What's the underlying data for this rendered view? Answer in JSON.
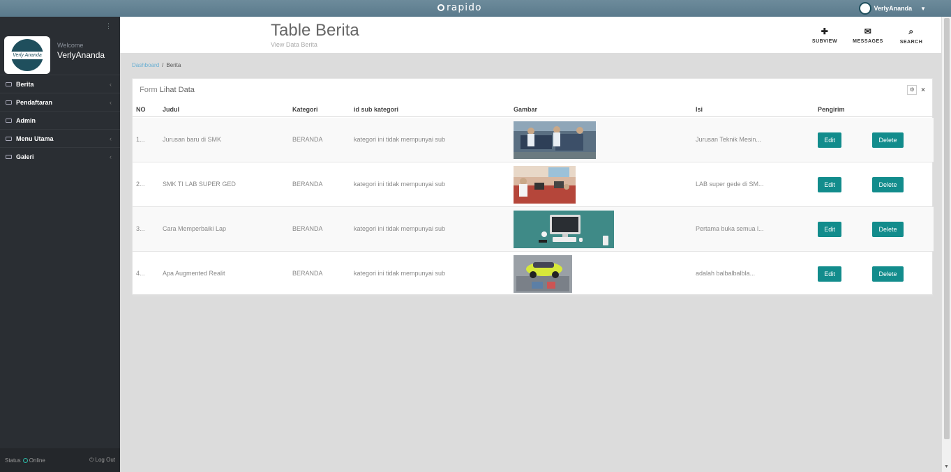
{
  "topbar": {
    "brand": "rapido",
    "user": "VerlyAnanda"
  },
  "sidebar": {
    "welcome": "Welcome",
    "username": "VerlyAnanda",
    "avatar_text": "Verly Ananda",
    "items": [
      {
        "label": "Berita"
      },
      {
        "label": "Pendaftaran"
      },
      {
        "label": "Admin"
      },
      {
        "label": "Menu Utama"
      },
      {
        "label": "Galeri"
      }
    ],
    "footer": {
      "status_label": "Status",
      "status_value": "Online",
      "logout": "Log Out"
    }
  },
  "header": {
    "title": "Table Berita",
    "subtitle": "View Data Berita",
    "buttons": [
      {
        "label": "SUBVIEW",
        "icon": "plus-icon"
      },
      {
        "label": "MESSAGES",
        "icon": "envelope-icon"
      },
      {
        "label": "SEARCH",
        "icon": "search-icon"
      }
    ]
  },
  "breadcrumb": {
    "link": "Dashboard",
    "separator": "/",
    "current": "Berita"
  },
  "panel": {
    "title_prefix": "Form",
    "title": "Lihat Data",
    "columns": [
      "NO",
      "Judul",
      "Kategori",
      "id sub kategori",
      "Gambar",
      "Isi",
      "Pengirim"
    ],
    "rows": [
      {
        "no": "1...",
        "judul": "Jurusan baru di SMK",
        "kategori": "BERANDA",
        "sub": "kategori ini tidak mempunyai sub",
        "isi": "Jurusan Teknik Mesin...",
        "edit": "Edit",
        "delete": "Delete",
        "image": "students-workshop-photo"
      },
      {
        "no": "2...",
        "judul": "SMK TI LAB SUPER GED",
        "kategori": "BERANDA",
        "sub": "kategori ini tidak mempunyai sub",
        "isi": "LAB super gede di SM...",
        "edit": "Edit",
        "delete": "Delete",
        "image": "computer-lab-photo"
      },
      {
        "no": "3...",
        "judul": "Cara Memperbaiki Lap",
        "kategori": "BERANDA",
        "sub": "kategori ini tidak mempunyai sub",
        "isi": "Pertama buka semua l...",
        "edit": "Edit",
        "delete": "Delete",
        "image": "desk-setup-illustration"
      },
      {
        "no": "4...",
        "judul": "Apa Augmented Realit",
        "kategori": "BERANDA",
        "sub": "kategori ini tidak mempunyai sub",
        "isi": "adalah balbalbalbla...",
        "edit": "Edit",
        "delete": "Delete",
        "image": "ar-car-photo"
      }
    ]
  },
  "colors": {
    "topbar": "#5a7a8c",
    "sidebar": "#2a2e33",
    "accent": "#128c8c",
    "link": "#6bb0d3"
  }
}
